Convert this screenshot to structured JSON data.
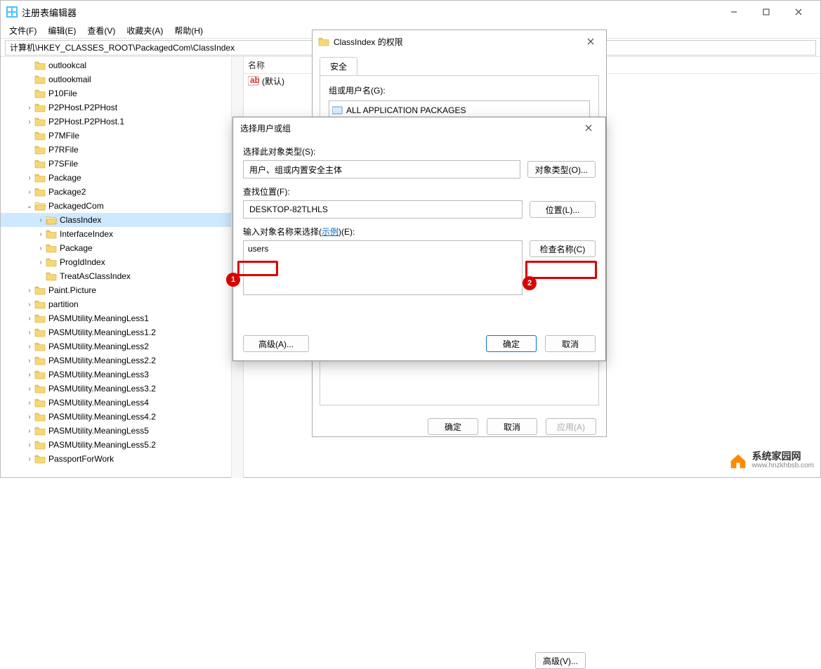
{
  "app": {
    "title": "注册表编辑器"
  },
  "menu": {
    "file": "文件(F)",
    "edit": "编辑(E)",
    "view": "查看(V)",
    "favorites": "收藏夹(A)",
    "help": "帮助(H)"
  },
  "address": "计算机\\HKEY_CLASSES_ROOT\\PackagedCom\\ClassIndex",
  "tree": [
    {
      "label": "outlookcal",
      "indent": 2,
      "arrow": ""
    },
    {
      "label": "outlookmail",
      "indent": 2,
      "arrow": ""
    },
    {
      "label": "P10File",
      "indent": 2,
      "arrow": ""
    },
    {
      "label": "P2PHost.P2PHost",
      "indent": 2,
      "arrow": ">"
    },
    {
      "label": "P2PHost.P2PHost.1",
      "indent": 2,
      "arrow": ">"
    },
    {
      "label": "P7MFile",
      "indent": 2,
      "arrow": ""
    },
    {
      "label": "P7RFile",
      "indent": 2,
      "arrow": ""
    },
    {
      "label": "P7SFile",
      "indent": 2,
      "arrow": ""
    },
    {
      "label": "Package",
      "indent": 2,
      "arrow": ">"
    },
    {
      "label": "Package2",
      "indent": 2,
      "arrow": ">"
    },
    {
      "label": "PackagedCom",
      "indent": 2,
      "arrow": "v",
      "open": true
    },
    {
      "label": "ClassIndex",
      "indent": 3,
      "arrow": ">",
      "selected": true,
      "open": true
    },
    {
      "label": "InterfaceIndex",
      "indent": 3,
      "arrow": ">"
    },
    {
      "label": "Package",
      "indent": 3,
      "arrow": ">"
    },
    {
      "label": "ProgIdIndex",
      "indent": 3,
      "arrow": ">"
    },
    {
      "label": "TreatAsClassIndex",
      "indent": 3,
      "arrow": ""
    },
    {
      "label": "Paint.Picture",
      "indent": 2,
      "arrow": ">"
    },
    {
      "label": "partition",
      "indent": 2,
      "arrow": ">"
    },
    {
      "label": "PASMUtility.MeaningLess1",
      "indent": 2,
      "arrow": ">"
    },
    {
      "label": "PASMUtility.MeaningLess1.2",
      "indent": 2,
      "arrow": ">"
    },
    {
      "label": "PASMUtility.MeaningLess2",
      "indent": 2,
      "arrow": ">"
    },
    {
      "label": "PASMUtility.MeaningLess2.2",
      "indent": 2,
      "arrow": ">"
    },
    {
      "label": "PASMUtility.MeaningLess3",
      "indent": 2,
      "arrow": ">"
    },
    {
      "label": "PASMUtility.MeaningLess3.2",
      "indent": 2,
      "arrow": ">"
    },
    {
      "label": "PASMUtility.MeaningLess4",
      "indent": 2,
      "arrow": ">"
    },
    {
      "label": "PASMUtility.MeaningLess4.2",
      "indent": 2,
      "arrow": ">"
    },
    {
      "label": "PASMUtility.MeaningLess5",
      "indent": 2,
      "arrow": ">"
    },
    {
      "label": "PASMUtility.MeaningLess5.2",
      "indent": 2,
      "arrow": ">"
    },
    {
      "label": "PassportForWork",
      "indent": 2,
      "arrow": ">"
    }
  ],
  "list": {
    "header": "名称",
    "default_row": "(默认)"
  },
  "perm_dialog": {
    "title": "ClassIndex 的权限",
    "tab": "安全",
    "group_label": "组或用户名(G):",
    "groups": [
      "ALL APPLICATION PACKAGES"
    ],
    "ok": "确定",
    "cancel": "取消",
    "apply": "应用(A)"
  },
  "perm_small_btn": "高级(V)...",
  "select_dialog": {
    "title": "选择用户或组",
    "obj_type_label": "选择此对象类型(S):",
    "obj_type_value": "用户、组或内置安全主体",
    "obj_type_btn": "对象类型(O)...",
    "location_label": "查找位置(F):",
    "location_value": "DESKTOP-82TLHLS",
    "location_btn": "位置(L)...",
    "names_label_prefix": "输入对象名称来选择(",
    "names_label_link": "示例",
    "names_label_suffix": ")(E):",
    "names_value": "users",
    "check_btn": "检查名称(C)",
    "advanced_btn": "高级(A)...",
    "ok": "确定",
    "cancel": "取消"
  },
  "callouts": {
    "b1": "1",
    "b2": "2"
  },
  "watermark": {
    "line1": "系统家园网",
    "line2": "www.hnzkhbsb.com"
  }
}
